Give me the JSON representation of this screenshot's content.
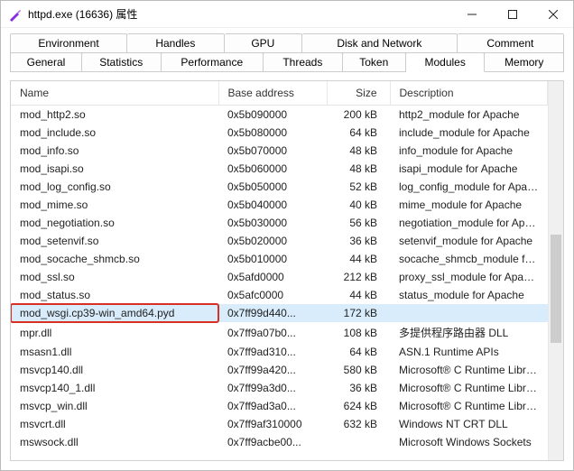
{
  "window": {
    "title": "httpd.exe (16636) 属性",
    "icon": "purple-knife-icon"
  },
  "tabs": {
    "row1": [
      {
        "label": "Environment"
      },
      {
        "label": "Handles"
      },
      {
        "label": "GPU"
      },
      {
        "label": "Disk and Network"
      },
      {
        "label": "Comment"
      }
    ],
    "row2": [
      {
        "label": "General"
      },
      {
        "label": "Statistics"
      },
      {
        "label": "Performance"
      },
      {
        "label": "Threads"
      },
      {
        "label": "Token"
      },
      {
        "label": "Modules",
        "active": true
      },
      {
        "label": "Memory"
      }
    ]
  },
  "columns": {
    "name": "Name",
    "base": "Base address",
    "size": "Size",
    "desc": "Description"
  },
  "rows": [
    {
      "name": "mod_http2.so",
      "base": "0x5b090000",
      "size": "200 kB",
      "desc": "http2_module for Apache"
    },
    {
      "name": "mod_include.so",
      "base": "0x5b080000",
      "size": "64 kB",
      "desc": "include_module for Apache"
    },
    {
      "name": "mod_info.so",
      "base": "0x5b070000",
      "size": "48 kB",
      "desc": "info_module for Apache"
    },
    {
      "name": "mod_isapi.so",
      "base": "0x5b060000",
      "size": "48 kB",
      "desc": "isapi_module for Apache"
    },
    {
      "name": "mod_log_config.so",
      "base": "0x5b050000",
      "size": "52 kB",
      "desc": "log_config_module for Apache"
    },
    {
      "name": "mod_mime.so",
      "base": "0x5b040000",
      "size": "40 kB",
      "desc": "mime_module for Apache"
    },
    {
      "name": "mod_negotiation.so",
      "base": "0x5b030000",
      "size": "56 kB",
      "desc": "negotiation_module for Apache"
    },
    {
      "name": "mod_setenvif.so",
      "base": "0x5b020000",
      "size": "36 kB",
      "desc": "setenvif_module for Apache"
    },
    {
      "name": "mod_socache_shmcb.so",
      "base": "0x5b010000",
      "size": "44 kB",
      "desc": "socache_shmcb_module for Apache"
    },
    {
      "name": "mod_ssl.so",
      "base": "0x5afd0000",
      "size": "212 kB",
      "desc": "proxy_ssl_module for Apache"
    },
    {
      "name": "mod_status.so",
      "base": "0x5afc0000",
      "size": "44 kB",
      "desc": "status_module for Apache"
    },
    {
      "name": "mod_wsgi.cp39-win_amd64.pyd",
      "base": "0x7ff99d440...",
      "size": "172 kB",
      "desc": "",
      "selected": true,
      "highlighted": true
    },
    {
      "name": "mpr.dll",
      "base": "0x7ff9a07b0...",
      "size": "108 kB",
      "desc": "多提供程序路由器 DLL"
    },
    {
      "name": "msasn1.dll",
      "base": "0x7ff9ad310...",
      "size": "64 kB",
      "desc": "ASN.1 Runtime APIs"
    },
    {
      "name": "msvcp140.dll",
      "base": "0x7ff99a420...",
      "size": "580 kB",
      "desc": "Microsoft® C Runtime Library"
    },
    {
      "name": "msvcp140_1.dll",
      "base": "0x7ff99a3d0...",
      "size": "36 kB",
      "desc": "Microsoft® C Runtime Library"
    },
    {
      "name": "msvcp_win.dll",
      "base": "0x7ff9ad3a0...",
      "size": "624 kB",
      "desc": "Microsoft® C Runtime Library"
    },
    {
      "name": "msvcrt.dll",
      "base": "0x7ff9af310000",
      "size": "632 kB",
      "desc": "Windows NT CRT DLL"
    },
    {
      "name": "mswsock.dll",
      "base": "0x7ff9acbe00...",
      "size": "",
      "desc": "Microsoft Windows Sockets"
    }
  ]
}
